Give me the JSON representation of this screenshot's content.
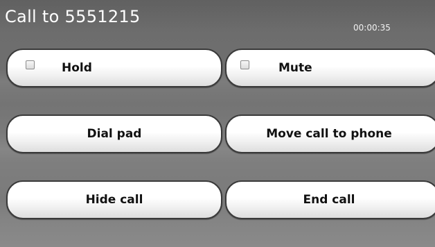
{
  "header": {
    "title": "Call to 5551215",
    "timer": "00:00:35"
  },
  "buttons": {
    "hold": {
      "label": "Hold",
      "checked": false
    },
    "mute": {
      "label": "Mute",
      "checked": false
    },
    "dial_pad": {
      "label": "Dial pad"
    },
    "move_call": {
      "label": "Move call to phone"
    },
    "hide_call": {
      "label": "Hide call"
    },
    "end_call": {
      "label": "End call"
    }
  }
}
